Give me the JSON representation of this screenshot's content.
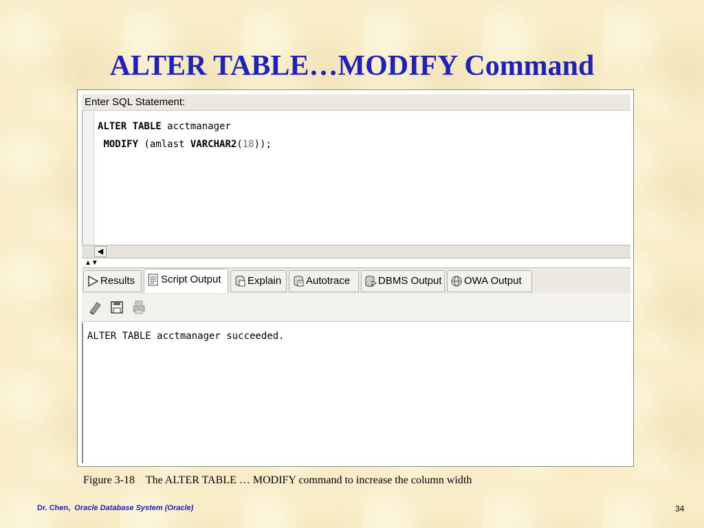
{
  "slide": {
    "title": "ALTER TABLE…MODIFY Command",
    "caption": "Figure 3-18    The ALTER TABLE … MODIFY command to increase the column width",
    "footer_author": "Dr. Chen,",
    "footer_course": "Oracle Database System  (Oracle)",
    "page_number": "34"
  },
  "sql_editor": {
    "prompt_label": "Enter SQL Statement:",
    "line1": {
      "kw": "ALTER TABLE",
      "rest": " acctmanager"
    },
    "line2": {
      "kw1": "MODIFY",
      "mid": " (amlast ",
      "kw2": "VARCHAR2",
      "open": "(",
      "num": "18",
      "close": "));"
    }
  },
  "results_panel": {
    "tabs": [
      {
        "label": "Results",
        "icon": "play-icon"
      },
      {
        "label": "Script Output",
        "icon": "script-icon",
        "active": true
      },
      {
        "label": "Explain",
        "icon": "explain-icon"
      },
      {
        "label": "Autotrace",
        "icon": "autotrace-icon"
      },
      {
        "label": "DBMS Output",
        "icon": "dbms-output-icon"
      },
      {
        "label": "OWA Output",
        "icon": "owa-output-icon"
      }
    ],
    "toolbar_icons": [
      "eraser-icon",
      "save-icon",
      "print-icon"
    ],
    "output_text": "ALTER TABLE acctmanager succeeded."
  }
}
